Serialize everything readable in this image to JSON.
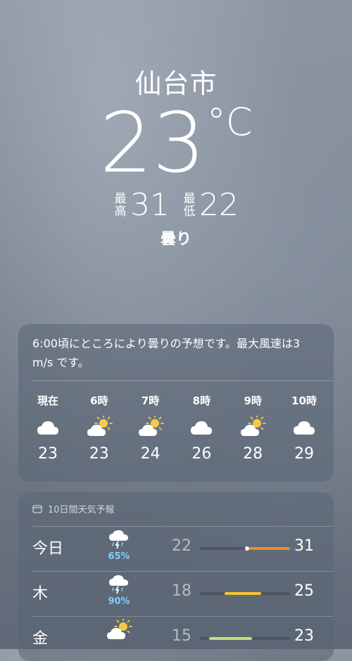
{
  "current": {
    "city": "仙台市",
    "temperature": "23",
    "unit": "°C",
    "high_label": "最高",
    "high": "31",
    "low_label": "最低",
    "low": "22",
    "condition": "曇り"
  },
  "hourly": {
    "summary": "6:00頃にところにより曇りの予想です。最大風速は3 m/s です。",
    "hours": [
      {
        "label": "現在",
        "icon": "cloud-icon",
        "temp": "23"
      },
      {
        "label": "6時",
        "icon": "partly-sunny-icon",
        "temp": "23"
      },
      {
        "label": "7時",
        "icon": "partly-sunny-icon",
        "temp": "24"
      },
      {
        "label": "8時",
        "icon": "cloud-icon",
        "temp": "26"
      },
      {
        "label": "9時",
        "icon": "partly-sunny-icon",
        "temp": "28"
      },
      {
        "label": "10時",
        "icon": "cloud-icon",
        "temp": "29"
      }
    ]
  },
  "daily": {
    "header": "10日間天気予報",
    "days": [
      {
        "day": "今日",
        "icon": "thunderstorm-rain-icon",
        "precip": "65%",
        "low": "22",
        "high": "31",
        "range_start": 0.55,
        "range_end": 1.0,
        "color": "#f08a24",
        "current_dot": 0.55
      },
      {
        "day": "木",
        "icon": "thunderstorm-rain-icon",
        "precip": "90%",
        "low": "18",
        "high": "25",
        "range_start": 0.27,
        "range_end": 0.68,
        "color": "#f4c430"
      },
      {
        "day": "金",
        "icon": "partly-sunny-icon",
        "precip": "",
        "low": "15",
        "high": "23",
        "range_start": 0.1,
        "range_end": 0.58,
        "color": "#c9dc7a"
      }
    ]
  },
  "colors": {
    "precip_text": "#7fd0ff",
    "sun": "#f7c948"
  }
}
